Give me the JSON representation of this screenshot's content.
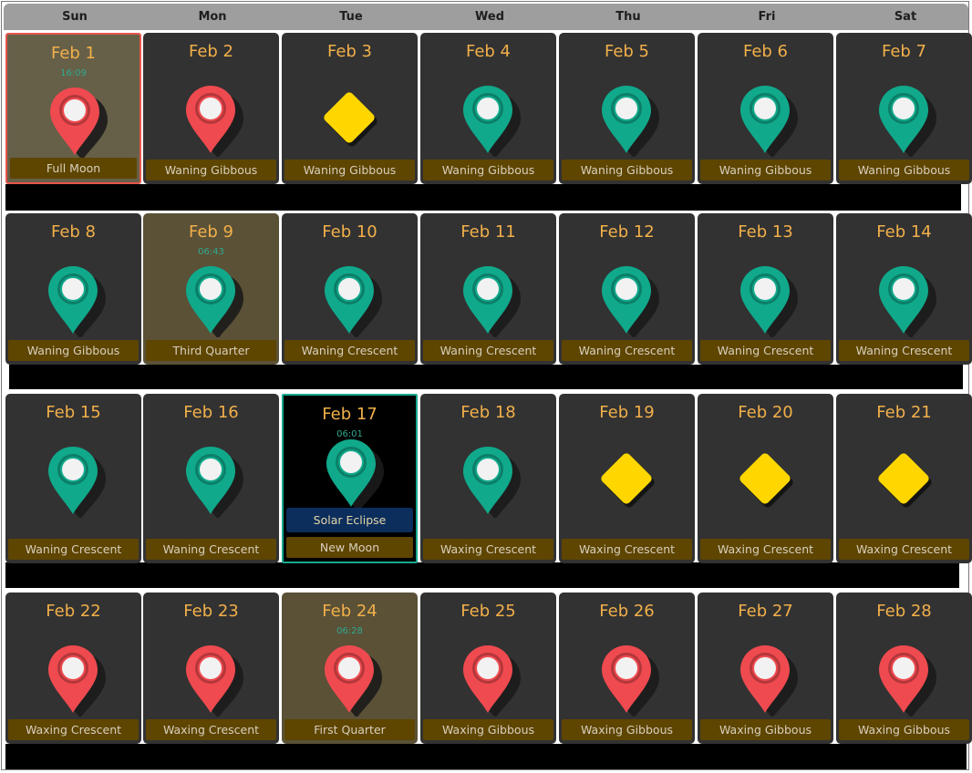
{
  "weekdays": [
    "Sun",
    "Mon",
    "Tue",
    "Wed",
    "Thu",
    "Fri",
    "Sat"
  ],
  "colors": {
    "red_pin": "#ef4a4f",
    "green_pin": "#10a98b",
    "yellow_diamond": "#ffd600",
    "date_text": "#f2b04a",
    "phase_bar": "#5e4500",
    "today_border": "#e8564b",
    "eclipse_border": "#18a98e"
  },
  "weeks": [
    {
      "days": [
        {
          "date": "Feb 1",
          "time": "16:09",
          "phase": "Full Moon",
          "icon": "red-pin-icon",
          "style": "today"
        },
        {
          "date": "Feb 2",
          "phase": "Waning Gibbous",
          "icon": "red-pin-icon"
        },
        {
          "date": "Feb 3",
          "phase": "Waning Gibbous",
          "icon": "yellow-diamond-icon"
        },
        {
          "date": "Feb 4",
          "phase": "Waning Gibbous",
          "icon": "green-pin-icon"
        },
        {
          "date": "Feb 5",
          "phase": "Waning Gibbous",
          "icon": "green-pin-icon"
        },
        {
          "date": "Feb 6",
          "phase": "Waning Gibbous",
          "icon": "green-pin-icon"
        },
        {
          "date": "Feb 7",
          "phase": "Waning Gibbous",
          "icon": "green-pin-icon"
        }
      ]
    },
    {
      "days": [
        {
          "date": "Feb 8",
          "phase": "Waning Gibbous",
          "icon": "green-pin-icon"
        },
        {
          "date": "Feb 9",
          "time": "06:43",
          "phase": "Third Quarter",
          "icon": "green-pin-icon",
          "style": "hl"
        },
        {
          "date": "Feb 10",
          "phase": "Waning Crescent",
          "icon": "green-pin-icon"
        },
        {
          "date": "Feb 11",
          "phase": "Waning Crescent",
          "icon": "green-pin-icon"
        },
        {
          "date": "Feb 12",
          "phase": "Waning Crescent",
          "icon": "green-pin-icon"
        },
        {
          "date": "Feb 13",
          "phase": "Waning Crescent",
          "icon": "green-pin-icon"
        },
        {
          "date": "Feb 14",
          "phase": "Waning Crescent",
          "icon": "green-pin-icon"
        }
      ]
    },
    {
      "days": [
        {
          "date": "Feb 15",
          "phase": "Waning Crescent",
          "icon": "green-pin-icon"
        },
        {
          "date": "Feb 16",
          "phase": "Waning Crescent",
          "icon": "green-pin-icon"
        },
        {
          "date": "Feb 17",
          "time": "06:01",
          "phase": "New Moon",
          "event": "Solar Eclipse",
          "icon": "green-pin-icon",
          "style": "eclipse"
        },
        {
          "date": "Feb 18",
          "phase": "Waxing Crescent",
          "icon": "green-pin-icon"
        },
        {
          "date": "Feb 19",
          "phase": "Waxing Crescent",
          "icon": "yellow-diamond-icon"
        },
        {
          "date": "Feb 20",
          "phase": "Waxing Crescent",
          "icon": "yellow-diamond-icon"
        },
        {
          "date": "Feb 21",
          "phase": "Waxing Crescent",
          "icon": "yellow-diamond-icon"
        }
      ]
    },
    {
      "days": [
        {
          "date": "Feb 22",
          "phase": "Waxing Crescent",
          "icon": "red-pin-icon"
        },
        {
          "date": "Feb 23",
          "phase": "Waxing Crescent",
          "icon": "red-pin-icon"
        },
        {
          "date": "Feb 24",
          "time": "06:28",
          "phase": "First Quarter",
          "icon": "red-pin-icon",
          "style": "hl"
        },
        {
          "date": "Feb 25",
          "phase": "Waxing Gibbous",
          "icon": "red-pin-icon"
        },
        {
          "date": "Feb 26",
          "phase": "Waxing Gibbous",
          "icon": "red-pin-icon"
        },
        {
          "date": "Feb 27",
          "phase": "Waxing Gibbous",
          "icon": "red-pin-icon"
        },
        {
          "date": "Feb 28",
          "phase": "Waxing Gibbous",
          "icon": "red-pin-icon"
        }
      ]
    }
  ]
}
